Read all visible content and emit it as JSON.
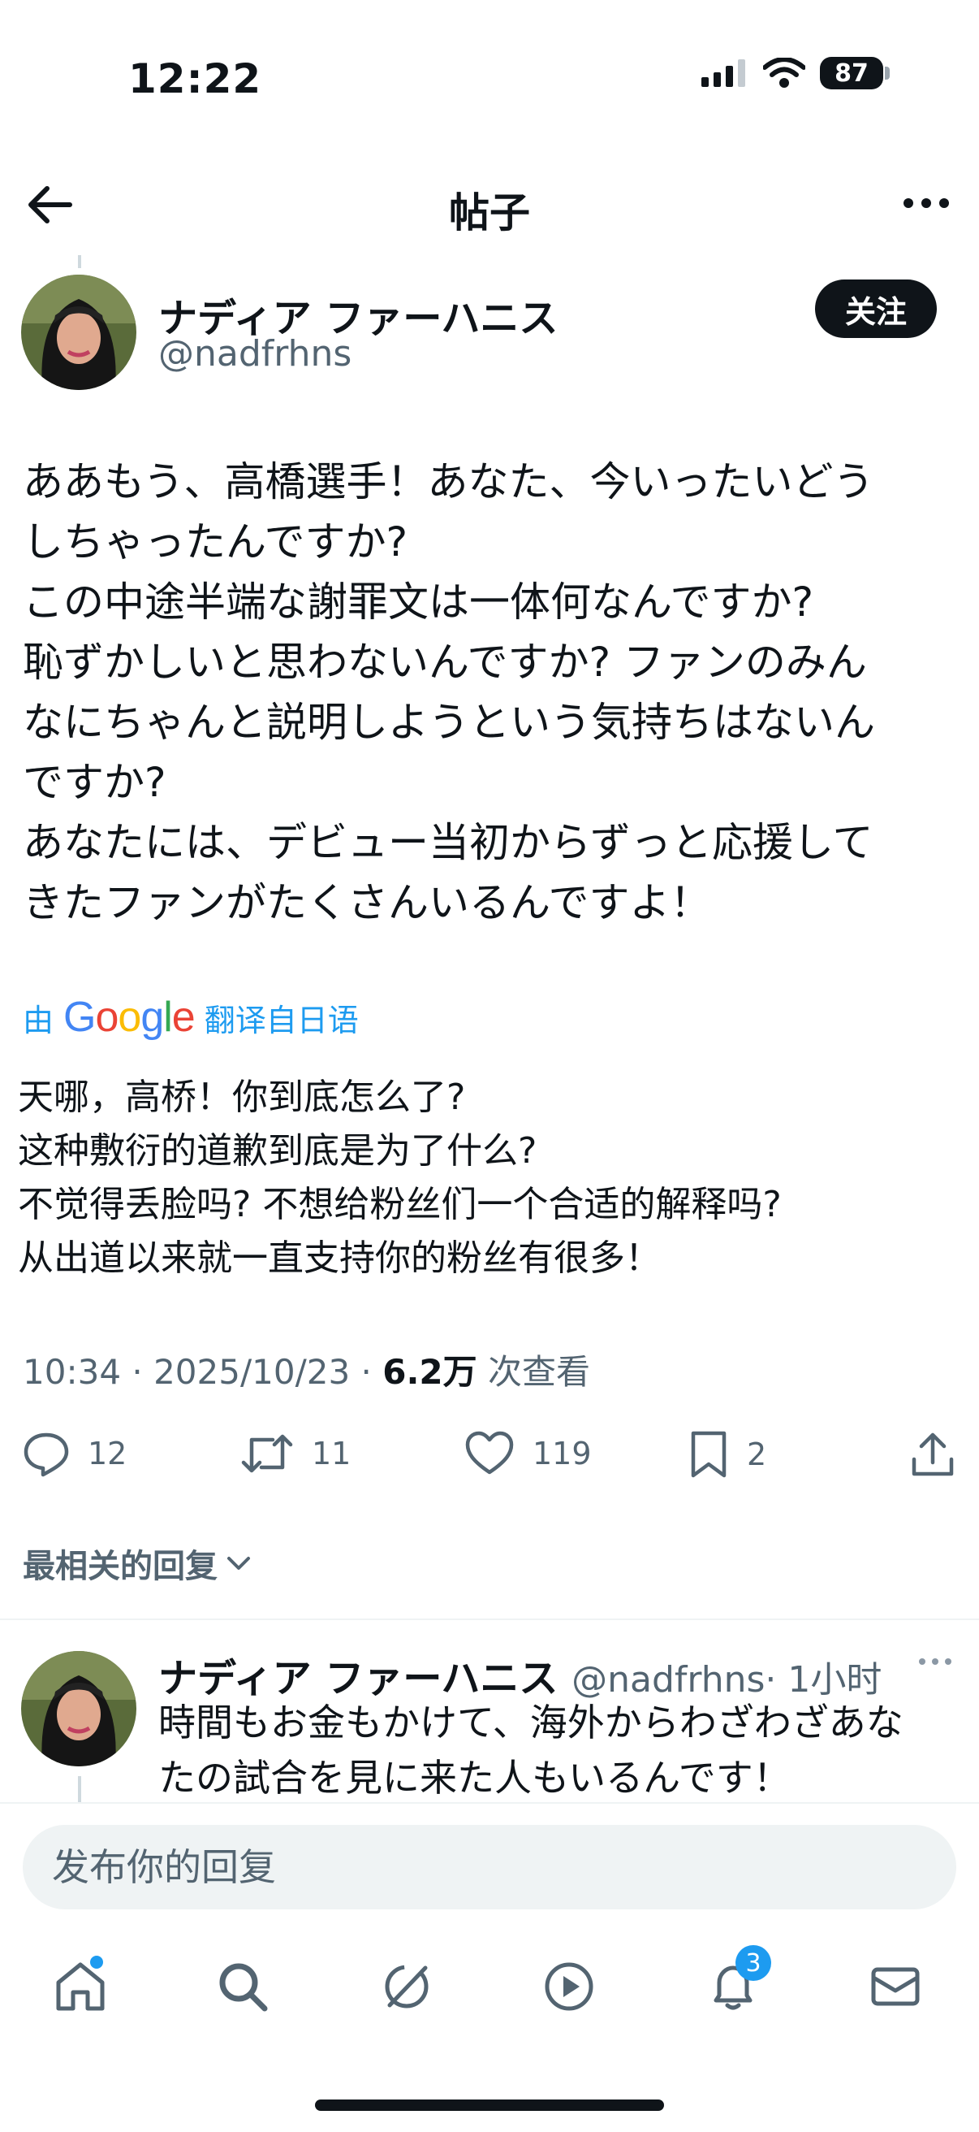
{
  "status": {
    "time": "12:22",
    "battery": "87"
  },
  "nav": {
    "title": "帖子"
  },
  "post": {
    "author_name": "ナディア ファーハニス",
    "author_handle": "@nadfrhns",
    "follow_label": "关注",
    "text": "ああもう、高橋選手！あなた、今いったいどう\nしちゃったんですか?\nこの中途半端な謝罪文は一体何なんですか?\n恥ずかしいと思わないんですか? ファンのみん\nなにちゃんと説明しようという気持ちはないん\nですか?\nあなたには、デビュー当初からずっと応援して\nきたファンがたくさんいるんですよ！",
    "translation_prefix": "由",
    "translation_brand": "Google",
    "translation_suffix": "翻译自日语",
    "translation": "天哪，高桥！你到底怎么了?\n这种敷衍的道歉到底是为了什么?\n不觉得丢脸吗? 不想给粉丝们一个合适的解释吗?\n从出道以来就一直支持你的粉丝有很多！",
    "meta_time": "10:34 · 2025/10/23 · ",
    "views_count": "6.2万",
    "views_label": " 次查看",
    "actions": {
      "replies": "12",
      "reposts": "11",
      "likes": "119",
      "bookmarks": "2"
    }
  },
  "sort_label": "最相关的回复",
  "reply": {
    "author_name": "ナディア ファーハニス",
    "author_handle": "@nadfrhns",
    "time": "· 1小时",
    "text": "時間もお金もかけて、海外からわざわざあな\nたの試合を見に来た人もいるんです！"
  },
  "compose": {
    "placeholder": "发布你的回复"
  },
  "tabbar": {
    "notifications_badge": "3"
  },
  "colors": {
    "accent": "#1d9bf0",
    "text": "#0f1419",
    "secondary": "#536471"
  }
}
